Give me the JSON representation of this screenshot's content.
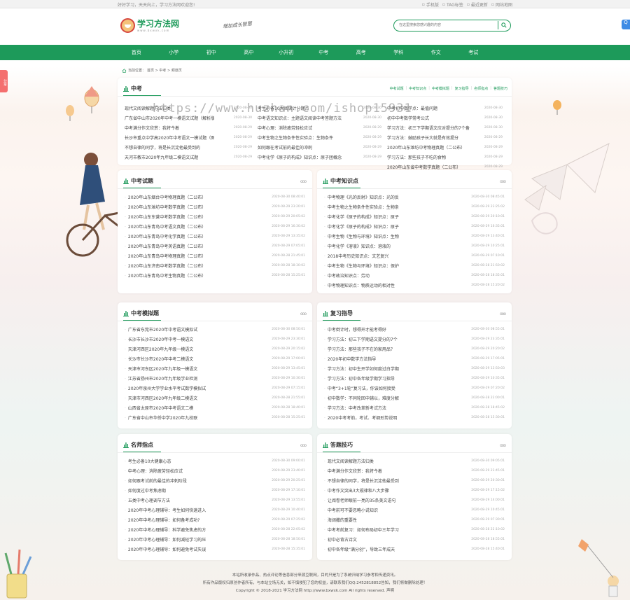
{
  "topbar": {
    "slogan": "好好学习，天天向上，学习方法网欢迎您!",
    "links": [
      {
        "icon": "mobile-icon",
        "label": "手机版"
      },
      {
        "icon": "tag-icon",
        "label": "TAG标签"
      },
      {
        "icon": "update-icon",
        "label": "最近更新"
      },
      {
        "icon": "sitemap-icon",
        "label": "网站地图"
      }
    ]
  },
  "header": {
    "logo_name": "学习方法网",
    "logo_url": "www.bxwxk.com",
    "slogan": "增加成长智慧",
    "search_placeholder": "在这里搜索您感兴趣的内容"
  },
  "nav": [
    "首页",
    "小学",
    "初中",
    "高中",
    "小升初",
    "中考",
    "高考",
    "学科",
    "作文",
    "考试"
  ],
  "breadcrumb": {
    "prefix": "当前位置：",
    "items": [
      "首页",
      "中考",
      "频道页"
    ],
    "sep": " > "
  },
  "side": {
    "share": "分享",
    "qq": "Q"
  },
  "zhongkao": {
    "title": "中考",
    "links": [
      "中考试题",
      "中考知识点",
      "中考模拟题",
      "复习指导",
      "名师指点",
      "答题技巧"
    ],
    "cols": [
      [
        [
          "现代文阅读解题方法归类",
          "2020-08-30"
        ],
        [
          "广东省中山市2020年中考一模语文试题（解析版）",
          "2020-08-30"
        ],
        [
          "中考满分作文欣赏：我将今着",
          "2020-08-29"
        ],
        [
          "长沙市重点中学高2020年中考语文一模试题（图",
          "2020-08-29"
        ],
        [
          "不想自律的同学，将是长沉淀他最受到的",
          "2020-08-29"
        ],
        [
          "天河市教市2020年九年级二模语文试题",
          "2020-08-29"
        ]
      ],
      [
        [
          "考生必备10大阅读计分题点",
          "2020-08-30"
        ],
        [
          "中考语文知识点：主题语文阅读中考答题方法",
          "2020-08-30"
        ],
        [
          "中考心理：消除疲劳轻松应试",
          "2020-08-29"
        ],
        [
          "中考生物之生物条件性实验点：生物条件",
          "2020-08-29"
        ],
        [
          "如何跟在考试前的最佳的冲刺",
          "2020-08-29"
        ],
        [
          "中考化学《原子的构成》知识点：原子团概念",
          "2020-08-29"
        ]
      ],
      [
        [
          "中考初中数学点：最值问题",
          "2020-08-30"
        ],
        [
          "初中中考数学常考公式",
          "2020-08-30"
        ],
        [
          "学习方法：初三下学期语文应对提分的7个备",
          "2020-08-30"
        ],
        [
          "学习方法：鼓励孩子长大就是有效提分",
          "2020-08-29"
        ],
        [
          "2020年山东潍坊中考物理真题（二公布）",
          "2020-08-29"
        ],
        [
          "学习方法：那些孩子不吃的食物",
          "2020-08-29"
        ],
        [
          "2020年山东省中考数学真题（二公布）",
          "2020-08-29"
        ]
      ]
    ]
  },
  "panels": [
    {
      "title": "中考试题",
      "more": "ooo",
      "rows": [
        [
          "2020年山东烟台中考物理真题（二公布）",
          "2020-08-30 08:40:01"
        ],
        [
          "2020年山东潍坊中考数学真题（二公布）",
          "2020-08-29 23:20:01"
        ],
        [
          "2020年山东东营中考数学真题（二公布）",
          "2020-08-29 20:05:02"
        ],
        [
          "2020年山东青岛中考语文真题（二公布）",
          "2020-08-29 16:30:02"
        ],
        [
          "2020年山东青岛中考化学真题（二公布）",
          "2020-08-29 13:35:02"
        ],
        [
          "2020年山东青岛中考英语真题（二公布）",
          "2020-08-29 07:05:01"
        ],
        [
          "2020年山东青岛中考物理真题（二公布）",
          "2020-08-28 21:45:01"
        ],
        [
          "2020年山东济南中考数学真题（二公布）",
          "2020-08-28 18:30:02"
        ],
        [
          "2020年山东青岛中考生物真题（二公布）",
          "2020-08-28 15:25:01"
        ]
      ]
    },
    {
      "title": "中考知识点",
      "more": "ooo",
      "rows": [
        [
          "中考物理《光的反射》知识点：光的反",
          "2020-08-30 08:45:01"
        ],
        [
          "中考生物之生物条件性实验点：生物条",
          "2020-08-29 23:25:02"
        ],
        [
          "中考化学《原子的构成》知识点：原子",
          "2020-08-29 20:10:01"
        ],
        [
          "中考化学《原子的构成》知识点：原子",
          "2020-08-29 16:35:01"
        ],
        [
          "中考生物《生物与环境》知识点：生物",
          "2020-08-29 13:40:01"
        ],
        [
          "中考化学《溶液》知识点：溶液的",
          "2020-08-29 10:25:01"
        ],
        [
          "2018中考历史知识点：文艺复兴",
          "2020-08-29 07:10:01"
        ],
        [
          "中考生物《生物与环境》知识点：保护",
          "2020-08-28 21:50:02"
        ],
        [
          "中考政治知识点：劳动",
          "2020-08-28 18:35:01"
        ],
        [
          "中考物理知识点：物质运动的相对性",
          "2020-08-28 15:20:02"
        ]
      ]
    },
    {
      "title": "中考模拟题",
      "more": "ooo",
      "rows": [
        [
          "广东省东莞市2020年中考语文模拟试",
          "2020-08-30 08:50:01"
        ],
        [
          "长沙市长沙市2020年中考一模语文",
          "2020-08-29 23:30:01"
        ],
        [
          "天津河西区2020年九年级一模语文",
          "2020-08-29 20:15:02"
        ],
        [
          "长沙市长沙市2020年中考二模语文",
          "2020-08-29 17:00:01"
        ],
        [
          "天津市河东区2020年九年级一模语文",
          "2020-08-29 13:45:01"
        ],
        [
          "江苏省扬州市2020年九年级学业检测",
          "2020-08-29 10:30:01"
        ],
        [
          "2020年泉州大学学业水平考试数学模拟试",
          "2020-08-29 07:15:01"
        ],
        [
          "天津市河西区2020年九年级二模语文",
          "2020-08-28 21:55:01"
        ],
        [
          "山西省太原市2020年中考语文二模",
          "2020-08-28 18:40:01"
        ],
        [
          "广东省中山市华侨中学2020年九校联",
          "2020-08-28 15:25:01"
        ]
      ]
    },
    {
      "title": "复习指导",
      "more": "ooo",
      "rows": [
        [
          "中考倒计时，想得开才能考得好",
          "2020-08-30 08:55:01"
        ],
        [
          "学习方法：初三下学期语文提分的7个",
          "2020-08-29 23:35:01"
        ],
        [
          "学习方法：那些孩子不在的家用品？",
          "2020-08-29 20:20:02"
        ],
        [
          "2020年初中数学方法指导",
          "2020-08-29 17:05:01"
        ],
        [
          "学习方法：初中生开学如何度过白学期",
          "2020-08-29 13:50:03"
        ],
        [
          "学习方法：初中各年级学期学习指导",
          "2020-08-29 10:35:01"
        ],
        [
          "中考“3+1轮”复习法，你该如何接受",
          "2020-08-29 07:20:02"
        ],
        [
          "初中数学：不同轮回中辅以，难度分解",
          "2020-08-28 22:00:01"
        ],
        [
          "学习方法：中考改革新考试方法",
          "2020-08-28 18:45:02"
        ],
        [
          "2020中考考前，考试、考纲形势说明",
          "2020-08-28 15:30:01"
        ]
      ]
    },
    {
      "title": "名师指点",
      "more": "ooo",
      "rows": [
        [
          "考生必备10大健康心态",
          "2020-08-30 09:00:01"
        ],
        [
          "中考心理：消除疲劳轻松应试",
          "2020-08-29 23:40:01"
        ],
        [
          "如何跟考试前的最佳的冲刺阶段",
          "2020-08-29 20:25:01"
        ],
        [
          "如何度过中考焦虑期",
          "2020-08-29 17:10:01"
        ],
        [
          "五类中考心理调节方法",
          "2020-08-29 13:55:01"
        ],
        [
          "2020年中考心理辅导：考生如何快速进入",
          "2020-08-29 10:40:01"
        ],
        [
          "2020年中考心理辅导：如何备考成功?",
          "2020-08-29 07:25:02"
        ],
        [
          "2020年中考心理辅导：科学避免焦虑的方",
          "2020-08-28 22:05:02"
        ],
        [
          "2020年中考心理辅导：如何减轻学习的压",
          "2020-08-28 18:50:01"
        ],
        [
          "2020年中考心理辅导：如何避免考试失误",
          "2020-08-28 15:35:01"
        ]
      ]
    },
    {
      "title": "答题技巧",
      "more": "ooo",
      "rows": [
        [
          "现代文阅读解题方法归类",
          "2020-08-30 09:05:01"
        ],
        [
          "中考满分作文欣赏：我将今着",
          "2020-08-29 23:45:01"
        ],
        [
          "不想自律的同学，将是长沉淀他最受到",
          "2020-08-29 20:30:01"
        ],
        [
          "中考作文突出3大规律和八大步骤",
          "2020-08-29 17:15:02"
        ],
        [
          "让阅卷老师眼前一亮的35条美文语句",
          "2020-08-29 14:00:01"
        ],
        [
          "中考前可不要忽略小说知识",
          "2020-08-29 10:45:01"
        ],
        [
          "海阔撒的重要性",
          "2020-08-29 07:30:01"
        ],
        [
          "中考考前复习：如何布局初中三年学习",
          "2020-08-28 22:10:02"
        ],
        [
          "初中必背古诗文",
          "2020-08-28 18:55:01"
        ],
        [
          "初中各年级“满分创”，导致三年成天",
          "2020-08-28 15:40:01"
        ]
      ]
    }
  ],
  "watermark": "https://www.huzhan.com/ishop15931",
  "footer": [
    "本站所收录作品、热点评论等信息部分来源互联网，目的只是为了系统归纳学习参考和传递资讯。",
    "所有作品版权归原创作者所有，与本站立场无关，如不慎侵犯了您的权益，请联系我们QQ:2452818852告知，我们将做删除处理！",
    "Copyright © 2018-2021 学习方法网 http://www.bxwxk.com All rights reserved. 声明"
  ],
  "colors": {
    "brand": "#1d9a5a",
    "share": "#f46f6f",
    "qq": "#3d8be5"
  }
}
